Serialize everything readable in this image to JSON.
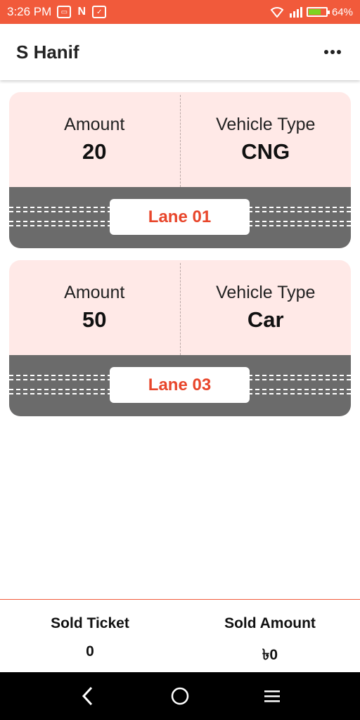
{
  "status_bar": {
    "time": "3:26 PM",
    "battery": "64%",
    "notification_icons": [
      "gallery-icon",
      "n-icon",
      "inbox-icon"
    ]
  },
  "header": {
    "title": "S Hanif",
    "menu_icon": "more-horizontal-icon"
  },
  "tickets": [
    {
      "amount_label": "Amount",
      "amount": "20",
      "vehicle_label": "Vehicle Type",
      "vehicle": "CNG",
      "lane": "Lane 01"
    },
    {
      "amount_label": "Amount",
      "amount": "50",
      "vehicle_label": "Vehicle Type",
      "vehicle": "Car",
      "lane": "Lane 03"
    }
  ],
  "summary": {
    "sold_ticket_label": "Sold Ticket",
    "sold_ticket_value": "0",
    "sold_amount_label": "Sold Amount",
    "sold_amount_value": "৳0"
  },
  "colors": {
    "accent": "#f15a3b",
    "card_bg": "#ffe9e7",
    "road": "#6b6b6b",
    "lane_text": "#e8462b"
  }
}
